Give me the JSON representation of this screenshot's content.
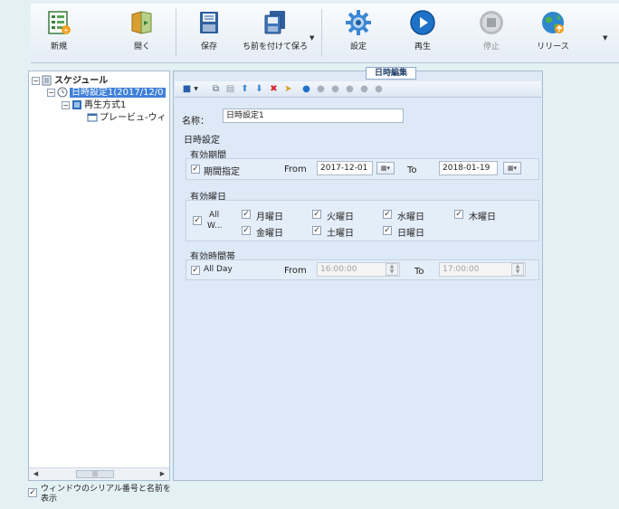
{
  "toolbar": {
    "buttons": [
      {
        "label": "新規",
        "icon": "new-schedule-icon"
      },
      {
        "label": "開く",
        "icon": "open-folder-icon"
      },
      {
        "label": "保存",
        "icon": "save-icon"
      },
      {
        "label": "ち前を付けて保ろ",
        "icon": "save-as-icon"
      },
      {
        "label": "設定",
        "icon": "gear-icon"
      },
      {
        "label": "再生",
        "icon": "play-icon"
      },
      {
        "label": "停止",
        "icon": "stop-icon"
      },
      {
        "label": "リリース",
        "icon": "globe-release-icon"
      }
    ]
  },
  "tree": {
    "root": "スケジュール",
    "datetime_node": "日時設定1(2017/12/0",
    "playback_node": "再生方式1",
    "preview_node": "プレービュ-ウィ"
  },
  "serial_option": {
    "label": "ウィンドウのシリアル番号と名前を表示",
    "checked": true
  },
  "editor": {
    "tab_title": "日時編集",
    "name_label": "名称：",
    "name_value": "日時設定1",
    "section_title": "日時設定",
    "period": {
      "title": "有効期間",
      "checkbox_label": "期間指定",
      "from_label": "From",
      "from_value": "2017-12-01",
      "to_label": "To",
      "to_value": "2018-01-19"
    },
    "weekdays": {
      "title": "有効曜日",
      "all_label_1": "All",
      "all_label_2": "W...",
      "days": [
        "月曜日",
        "火曜日",
        "水曜日",
        "木曜日",
        "金曜日",
        "土曜日",
        "日曜日"
      ]
    },
    "timeband": {
      "title": "有効時間帯",
      "checkbox_label": "All Day",
      "from_label": "From",
      "from_value": "16:00:00",
      "to_label": "To",
      "to_value": "17:00:00"
    }
  },
  "colors": {
    "accent": "#3f80d8",
    "background": "#e3f1f4",
    "panel": "#dde9f6"
  }
}
